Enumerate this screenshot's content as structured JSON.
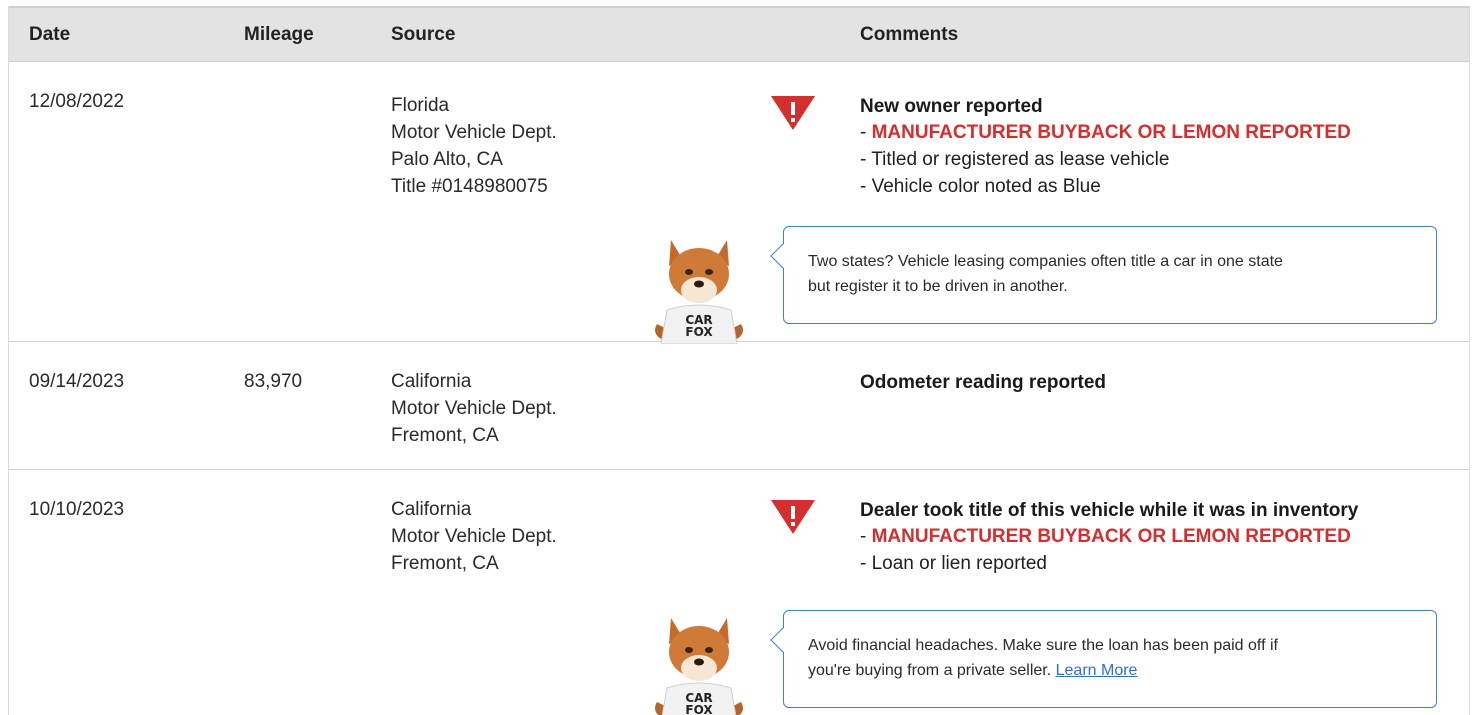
{
  "header": {
    "date": "Date",
    "mileage": "Mileage",
    "source": "Source",
    "comments": "Comments"
  },
  "rows": [
    {
      "date": "12/08/2022",
      "mileage": "",
      "source": [
        "Florida",
        "Motor Vehicle Dept.",
        "Palo Alto, CA",
        "Title #0148980075"
      ],
      "comment_title": "New owner reported",
      "comment_lines": [
        {
          "prefix": "- ",
          "text": "MANUFACTURER BUYBACK OR LEMON REPORTED"
        },
        {
          "prefix": "- ",
          "text": "Titled or registered as lease vehicle"
        },
        {
          "prefix": "- ",
          "text": "Vehicle color noted as Blue"
        }
      ],
      "tip": {
        "line1": "Two states? Vehicle leasing companies often title a car in one state",
        "line2": "but register it to be driven in another.",
        "link": ""
      }
    },
    {
      "date": "09/14/2023",
      "mileage": "83,970",
      "source": [
        "California",
        "Motor Vehicle Dept.",
        "Fremont, CA"
      ],
      "comment_title": "Odometer reading reported"
    },
    {
      "date": "10/10/2023",
      "mileage": "",
      "source": [
        "California",
        "Motor Vehicle Dept.",
        "Fremont, CA"
      ],
      "comment_title": "Dealer took title of this vehicle while it was in inventory",
      "comment_lines": [
        {
          "prefix": "- ",
          "text": "MANUFACTURER BUYBACK OR LEMON REPORTED"
        },
        {
          "prefix": "- ",
          "text": "Loan or lien reported"
        }
      ],
      "tip": {
        "line1": "Avoid financial headaches. Make sure the loan has been paid off if",
        "line2": "you're buying from a private seller.",
        "link": "Learn More"
      }
    }
  ],
  "mascot": {
    "shirt_line1": "CAR",
    "shirt_line2": "FOX"
  },
  "colors": {
    "alert_red": "#d32f2f",
    "link_blue": "#2f6fd0",
    "bubble_border": "#3d7fd6",
    "header_bg": "#e3e3e3"
  },
  "icons": {
    "alert": "warning-triangle-icon",
    "mascot": "carfox-mascot-icon"
  }
}
